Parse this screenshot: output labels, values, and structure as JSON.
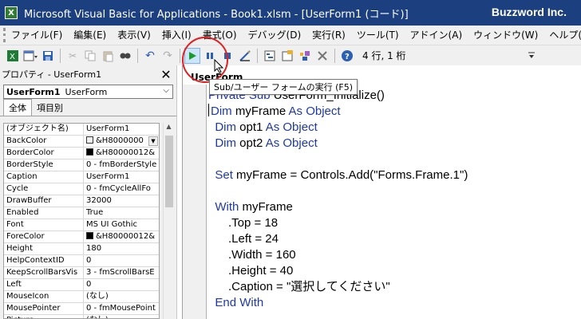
{
  "titlebar": {
    "app_icon": "excel-icon",
    "title": "Microsoft Visual Basic for Applications - Book1.xlsm - [UserForm1 (コード)]",
    "brand": "Buzzword Inc."
  },
  "menubar": {
    "items": [
      "ファイル(F)",
      "編集(E)",
      "表示(V)",
      "挿入(I)",
      "書式(O)",
      "デバッグ(D)",
      "実行(R)",
      "ツール(T)",
      "アドイン(A)",
      "ウィンドウ(W)",
      "ヘルプ(H)"
    ]
  },
  "toolbar": {
    "status": "4 行, 1 桁",
    "tooltip": "Sub/ユーザー フォームの実行 (F5)",
    "highlight_color": "#e02020"
  },
  "properties": {
    "header": "プロパティ - UserForm1",
    "object_name": "UserForm1",
    "object_type": "UserForm",
    "tabs": [
      "全体",
      "項目別"
    ],
    "rows": [
      {
        "name": "(オブジェクト名)",
        "value": "UserForm1"
      },
      {
        "name": "BackColor",
        "value": "&H8000000",
        "swatch": "#f0f0f0",
        "dropdown": true
      },
      {
        "name": "BorderColor",
        "value": "&H80000012&",
        "swatch": "#000000"
      },
      {
        "name": "BorderStyle",
        "value": "0 - fmBorderStyle"
      },
      {
        "name": "Caption",
        "value": "UserForm1"
      },
      {
        "name": "Cycle",
        "value": "0 - fmCycleAllFo"
      },
      {
        "name": "DrawBuffer",
        "value": "32000"
      },
      {
        "name": "Enabled",
        "value": "True"
      },
      {
        "name": "Font",
        "value": "MS UI Gothic"
      },
      {
        "name": "ForeColor",
        "value": "&H80000012&",
        "swatch": "#000000"
      },
      {
        "name": "Height",
        "value": "180"
      },
      {
        "name": "HelpContextID",
        "value": "0"
      },
      {
        "name": "KeepScrollBarsVis",
        "value": "3 - fmScrollBarsE"
      },
      {
        "name": "Left",
        "value": "0"
      },
      {
        "name": "MouseIcon",
        "value": "(なし)"
      },
      {
        "name": "MousePointer",
        "value": "0 - fmMousePoint"
      },
      {
        "name": "Picture",
        "value": "(なし)"
      }
    ]
  },
  "code": {
    "header": "UserForm",
    "lines": [
      [
        {
          "t": "Private Sub ",
          "k": true
        },
        {
          "t": "UserForm_Initialize()"
        }
      ],
      [
        {
          "t": "  "
        },
        {
          "t": "Dim ",
          "k": true
        },
        {
          "t": "myFrame "
        },
        {
          "t": "As Object",
          "k": true
        }
      ],
      [
        {
          "t": "  "
        },
        {
          "t": "Dim ",
          "k": true
        },
        {
          "t": "opt1 "
        },
        {
          "t": "As Object",
          "k": true
        }
      ],
      [
        {
          "t": "  "
        },
        {
          "t": "Dim ",
          "k": true
        },
        {
          "t": "opt2 "
        },
        {
          "t": "As Object",
          "k": true
        }
      ],
      [],
      [
        {
          "t": "  "
        },
        {
          "t": "Set ",
          "k": true
        },
        {
          "t": "myFrame = Controls.Add(\"Forms.Frame.1\")"
        }
      ],
      [],
      [
        {
          "t": "  "
        },
        {
          "t": "With ",
          "k": true
        },
        {
          "t": "myFrame"
        }
      ],
      [
        {
          "t": "      .Top = 18"
        }
      ],
      [
        {
          "t": "      .Left = 24"
        }
      ],
      [
        {
          "t": "      .Width = 160"
        }
      ],
      [
        {
          "t": "      .Height = 40"
        }
      ],
      [
        {
          "t": "      .Caption = \"選択してください\""
        }
      ],
      [
        {
          "t": "  "
        },
        {
          "t": "End With",
          "k": true
        }
      ]
    ]
  },
  "colors": {
    "titlebar_bg": "#1c3f80",
    "keyword": "#1f3aa6"
  }
}
